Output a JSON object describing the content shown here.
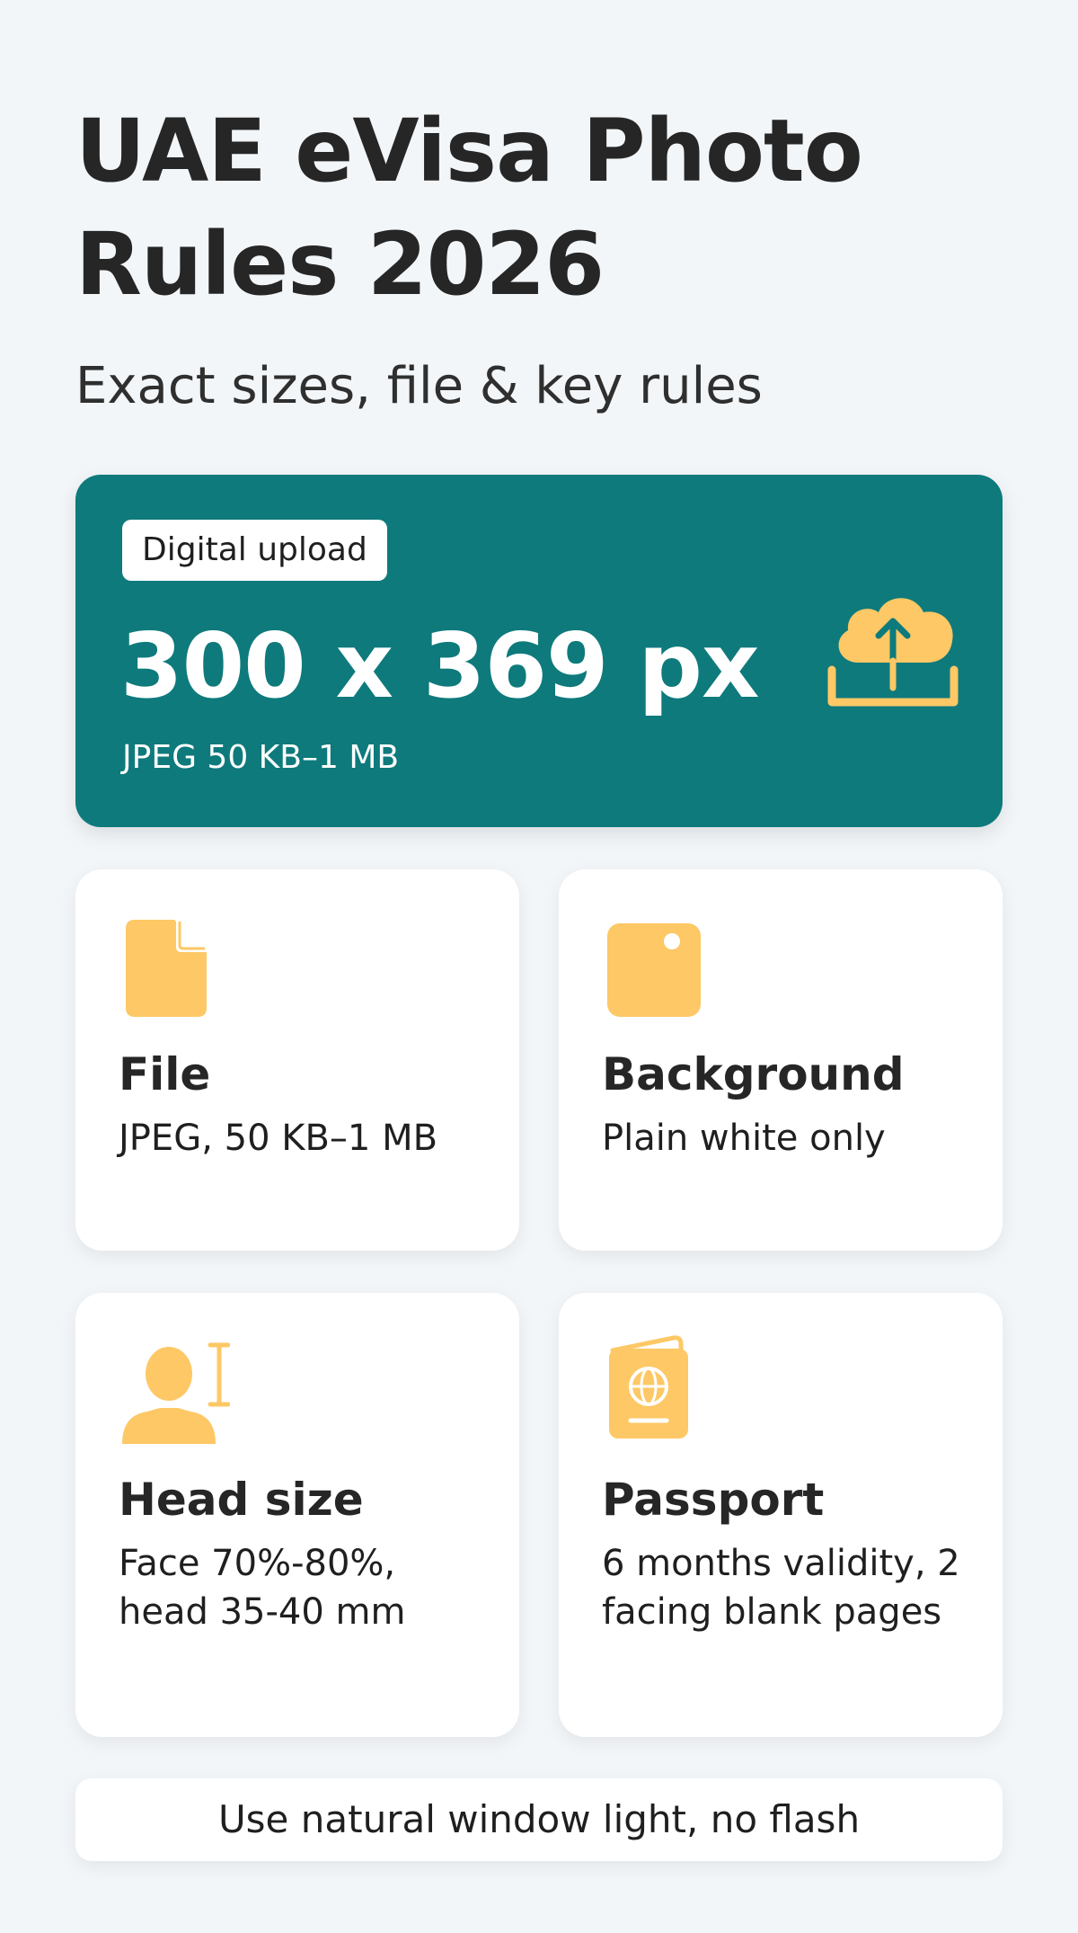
{
  "header": {
    "title": "UAE eVisa Photo Rules 2026",
    "subtitle": "Exact sizes, file & key rules"
  },
  "hero": {
    "badge": "Digital upload",
    "size": "300 x 369 px",
    "spec": "JPEG 50 KB–1 MB",
    "icon": "cloud-upload-icon"
  },
  "cards": [
    {
      "icon": "file-icon",
      "title": "File",
      "text": "JPEG, 50 KB–1 MB"
    },
    {
      "icon": "background-icon",
      "title": "Background",
      "text": "Plain white only"
    },
    {
      "icon": "head-size-icon",
      "title": "Head size",
      "text": "Face 70%-80%, head 35-40 mm"
    },
    {
      "icon": "passport-icon",
      "title": "Passport",
      "text": "6 months validity, 2 facing blank pages"
    }
  ],
  "footer": {
    "tip": "Use natural window light, no flash"
  },
  "colors": {
    "background": "#f3f6f9",
    "hero": "#0e7a7c",
    "accent": "#fdc865",
    "text": "#262626"
  }
}
